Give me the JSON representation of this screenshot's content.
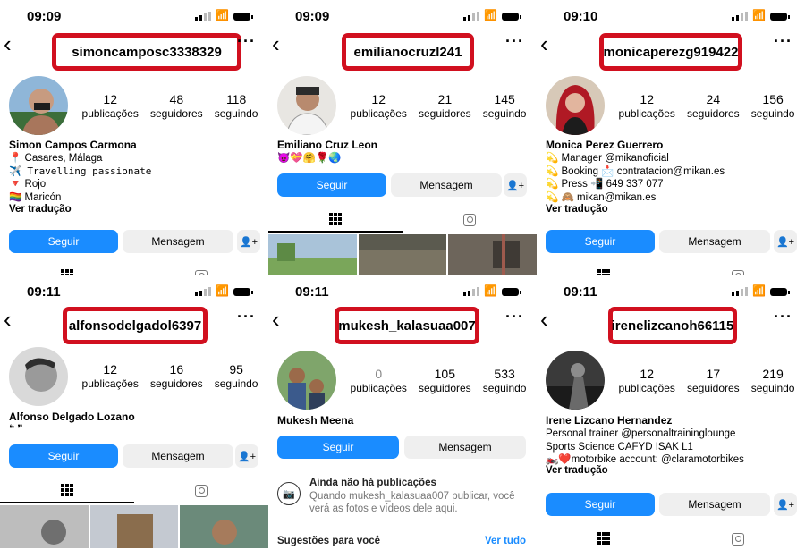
{
  "colors": {
    "accent": "#1a8cff",
    "highlight": "#d1101f",
    "button_bg": "#efefef"
  },
  "labels": {
    "posts": "publicações",
    "followers": "seguidores",
    "following": "seguindo",
    "follow": "Seguir",
    "message": "Mensagem",
    "translate": "Ver tradução",
    "add_user_icon": "add-user-icon",
    "grid_icon": "grid-icon",
    "tagged_icon": "tagged-icon"
  },
  "profiles": [
    {
      "time": "09:09",
      "username": "simoncamposc3338329",
      "posts": "12",
      "followers": "48",
      "following": "118",
      "full_name": "Simon Campos Carmona",
      "bio": [
        "📍 Casares, Málaga",
        "✈️ Travelling passionate",
        "🔻 Rojo",
        "🏳️‍🌈 Maricón"
      ]
    },
    {
      "time": "09:09",
      "username": "emilianocruzl241",
      "posts": "12",
      "followers": "21",
      "following": "145",
      "full_name": "Emiliano Cruz Leon",
      "bio": [
        "😈💝🤗🌹🌏"
      ]
    },
    {
      "time": "09:10",
      "username": "monicaperezg919422",
      "posts": "12",
      "followers": "24",
      "following": "156",
      "full_name": "Monica Perez Guerrero",
      "bio": [
        "💫 Manager @mikanoficial",
        "💫 Booking 📩 contratacion@mikan.es",
        "💫 Press 📲 649 337 077",
        "💫 🙈 mikan@mikan.es"
      ]
    },
    {
      "time": "09:11",
      "username": "alfonsodelgadol6397",
      "posts": "12",
      "followers": "16",
      "following": "95",
      "full_name": "Alfonso Delgado Lozano",
      "bio": [
        "❝ ❞"
      ]
    },
    {
      "time": "09:11",
      "username": "mukesh_kalasuaa007",
      "posts": "0",
      "followers": "105",
      "following": "533",
      "full_name": "Mukesh Meena",
      "bio": [],
      "empty_title": "Ainda não há publicações",
      "empty_text": "Quando mukesh_kalasuaa007 publicar, você verá as fotos e vídeos dele aqui.",
      "suggestions": "Sugestões para você",
      "see_all": "Ver tudo"
    },
    {
      "time": "09:11",
      "username": "irenelizcanoh66115",
      "posts": "12",
      "followers": "17",
      "following": "219",
      "full_name": "Irene Lizcano Hernandez",
      "bio": [
        "Personal trainer @personaltraininglounge",
        "Sports Science CAFYD ISAK L1",
        "🏍️❤️motorbike account: @claramotorbikes"
      ]
    }
  ]
}
